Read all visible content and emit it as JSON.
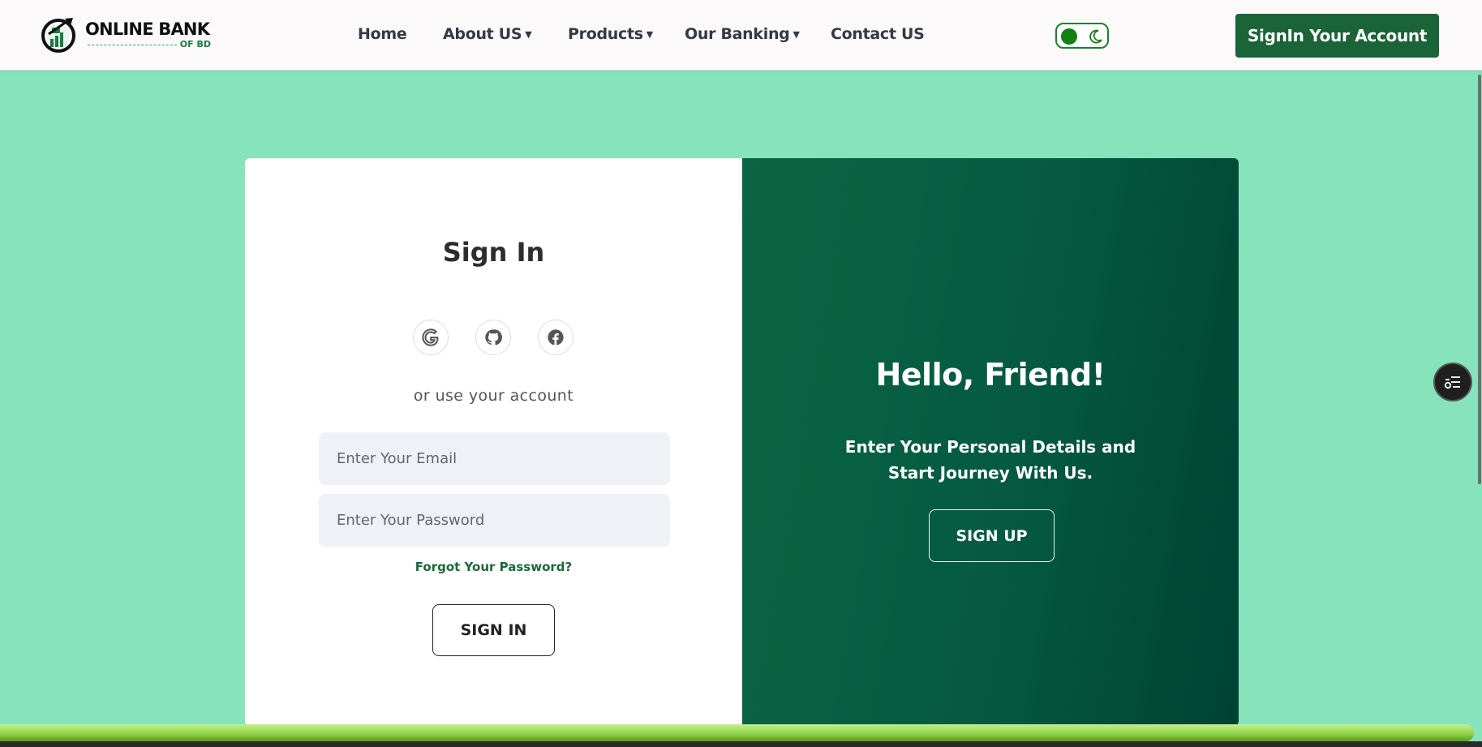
{
  "brand": {
    "title": "ONLINE BANK",
    "subtitle": "OF BD"
  },
  "nav": {
    "items": [
      {
        "label": "Home",
        "has_dropdown": false
      },
      {
        "label": "About US",
        "has_dropdown": true
      },
      {
        "label": "Products",
        "has_dropdown": true
      },
      {
        "label": "Our Banking",
        "has_dropdown": true
      },
      {
        "label": "Contact US",
        "has_dropdown": false
      }
    ],
    "cta_label": "SignIn Your Account",
    "theme_toggle": {
      "state": "light",
      "icon": "moon-icon"
    }
  },
  "signin": {
    "title": "Sign In",
    "social": [
      {
        "name": "google",
        "icon": "google-icon"
      },
      {
        "name": "github",
        "icon": "github-icon"
      },
      {
        "name": "facebook",
        "icon": "facebook-icon"
      }
    ],
    "alt_text": "or use your account",
    "email_placeholder": "Enter Your Email",
    "email_value": "",
    "password_placeholder": "Enter Your Password",
    "password_value": "",
    "forgot_label": "Forgot Your Password?",
    "button_label": "SIGN IN"
  },
  "signup_panel": {
    "title": "Hello, Friend!",
    "text": "Enter Your Personal Details and Start Journey With Us.",
    "button_label": "SIGN UP"
  },
  "floating_button": {
    "icon": "settings-list-icon"
  },
  "colors": {
    "page_bg": "#86e3bc",
    "nav_bg": "#fbf9fa",
    "brand_green": "#1b6437",
    "panel_gradient_start": "#0b6544",
    "panel_gradient_end": "#004232",
    "link_green": "#1a6a36",
    "progress_green": "#8fd34a"
  }
}
